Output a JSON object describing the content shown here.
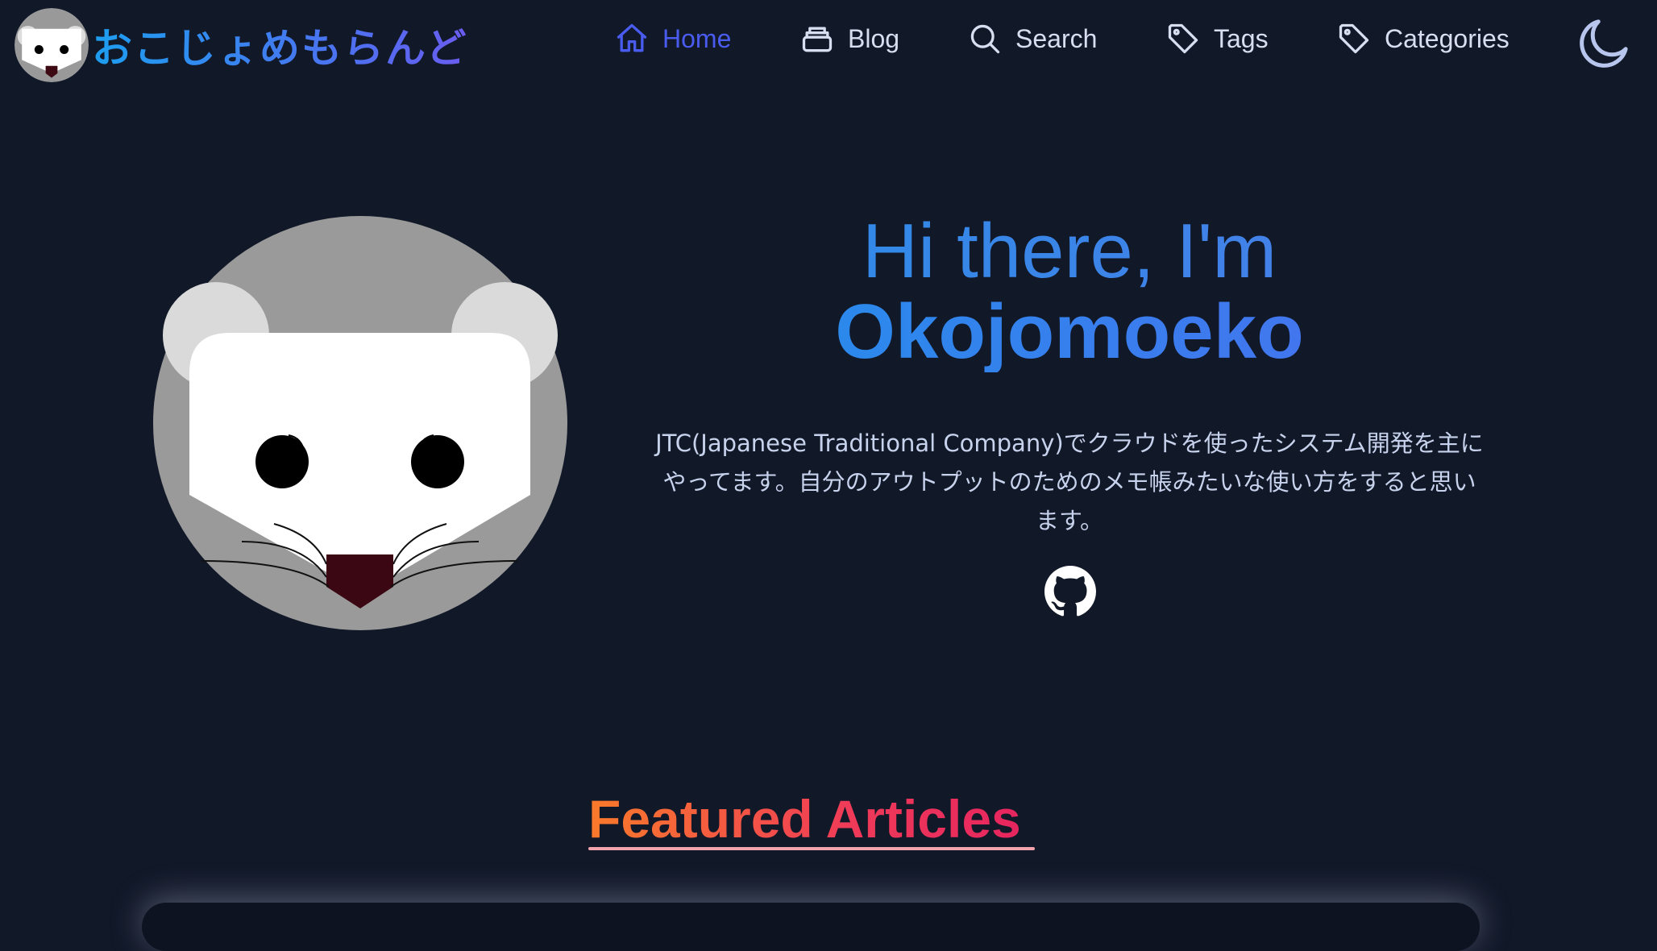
{
  "site": {
    "title": "おこじょめもらんど",
    "logo_icon": "okojo-avatar-icon"
  },
  "nav": {
    "items": [
      {
        "label": "Home",
        "icon": "home-icon",
        "active": true
      },
      {
        "label": "Blog",
        "icon": "blog-stack-icon",
        "active": false
      },
      {
        "label": "Search",
        "icon": "search-icon",
        "active": false
      },
      {
        "label": "Tags",
        "icon": "tag-icon",
        "active": false
      },
      {
        "label": "Categories",
        "icon": "tag-icon",
        "active": false
      }
    ],
    "theme_toggle_icon": "moon-icon"
  },
  "hero": {
    "greeting": "Hi there, I'm",
    "name": "Okojomoeko",
    "bio": "JTC(Japanese Traditional Company)でクラウドを使ったシステム開発を主にやってます。自分のアウトプットのためのメモ帳みたいな使い方をすると思います。",
    "github_icon": "github-icon"
  },
  "featured": {
    "title": "Featured Articles"
  },
  "colors": {
    "background": "#111828",
    "nav_active": "#4a5cf0",
    "nav_text": "#d7def0",
    "accent_blue": "#2b8ce8",
    "accent_orange": "#f97a2a",
    "accent_pink": "#e6255f"
  }
}
